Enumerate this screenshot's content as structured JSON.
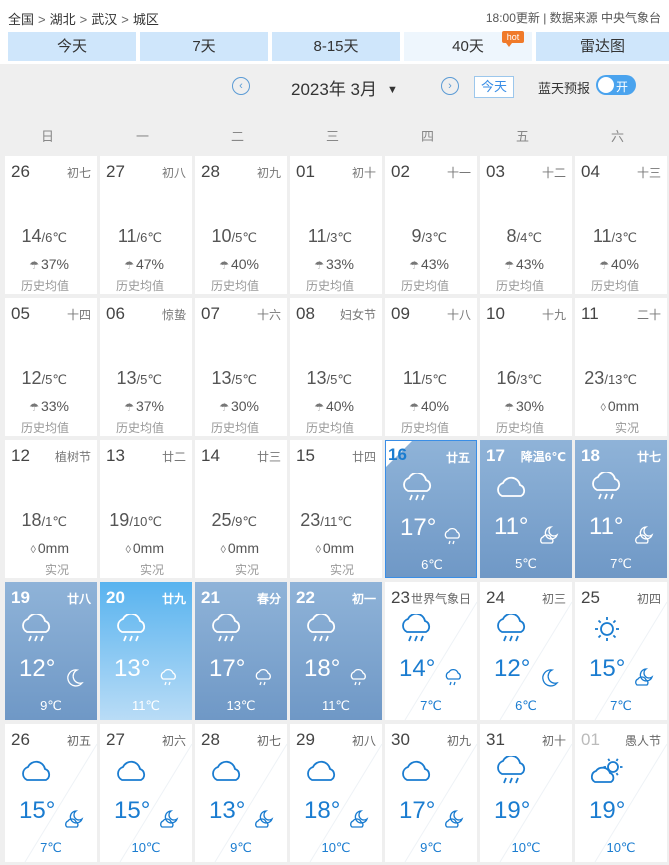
{
  "breadcrumb": {
    "items": [
      "全国",
      "湖北",
      "武汉",
      "城区"
    ],
    "sep": ">"
  },
  "source_text": "18:00更新 | 数据来源 中央气象台",
  "tabs": [
    {
      "label": "今天"
    },
    {
      "label": "7天"
    },
    {
      "label": "8-15天"
    },
    {
      "label": "40天",
      "badge": "hot",
      "active": true
    },
    {
      "label": "雷达图"
    }
  ],
  "controls": {
    "prev": "‹",
    "next": "›",
    "month_label": "2023年 3月",
    "caret": "▼",
    "today": "今天",
    "sky_label": "蓝天预报",
    "toggle_label": "开"
  },
  "weekdays": [
    "日",
    "一",
    "二",
    "三",
    "四",
    "五",
    "六"
  ],
  "history_label": "历史均值",
  "actual_label": "实况",
  "weeks": [
    [
      {
        "day": "26",
        "lunar": "初七",
        "kind": "hist",
        "high": "14",
        "low": "6℃",
        "rain": "37%"
      },
      {
        "day": "27",
        "lunar": "初八",
        "kind": "hist",
        "high": "11",
        "low": "6℃",
        "rain": "47%"
      },
      {
        "day": "28",
        "lunar": "初九",
        "kind": "hist",
        "high": "10",
        "low": "5℃",
        "rain": "40%"
      },
      {
        "day": "01",
        "lunar": "初十",
        "kind": "hist",
        "high": "11",
        "low": "3℃",
        "rain": "33%"
      },
      {
        "day": "02",
        "lunar": "十一",
        "kind": "hist",
        "high": "9",
        "low": "3℃",
        "rain": "43%"
      },
      {
        "day": "03",
        "lunar": "十二",
        "kind": "hist",
        "high": "8",
        "low": "4℃",
        "rain": "43%"
      },
      {
        "day": "04",
        "lunar": "十三",
        "kind": "hist",
        "high": "11",
        "low": "3℃",
        "rain": "40%"
      }
    ],
    [
      {
        "day": "05",
        "lunar": "十四",
        "kind": "hist",
        "high": "12",
        "low": "5℃",
        "rain": "33%"
      },
      {
        "day": "06",
        "lunar": "惊蛰",
        "kind": "hist",
        "high": "13",
        "low": "5℃",
        "rain": "37%"
      },
      {
        "day": "07",
        "lunar": "十六",
        "kind": "hist",
        "high": "13",
        "low": "5℃",
        "rain": "30%"
      },
      {
        "day": "08",
        "lunar": "妇女节",
        "kind": "hist",
        "high": "13",
        "low": "5℃",
        "rain": "40%"
      },
      {
        "day": "09",
        "lunar": "十八",
        "kind": "hist",
        "high": "11",
        "low": "5℃",
        "rain": "40%"
      },
      {
        "day": "10",
        "lunar": "十九",
        "kind": "hist",
        "high": "16",
        "low": "3℃",
        "rain": "30%"
      },
      {
        "day": "11",
        "lunar": "二十",
        "kind": "actual",
        "high": "23",
        "low": "13℃",
        "rain": "0mm"
      }
    ],
    [
      {
        "day": "12",
        "lunar": "植树节",
        "kind": "actual",
        "high": "18",
        "low": "1℃",
        "rain": "0mm"
      },
      {
        "day": "13",
        "lunar": "廿二",
        "kind": "actual",
        "high": "19",
        "low": "10℃",
        "rain": "0mm"
      },
      {
        "day": "14",
        "lunar": "廿三",
        "kind": "actual",
        "high": "25",
        "low": "9℃",
        "rain": "0mm"
      },
      {
        "day": "15",
        "lunar": "廿四",
        "kind": "actual",
        "high": "23",
        "low": "11℃",
        "rain": "0mm"
      },
      {
        "day": "16",
        "lunar": "廿五",
        "kind": "fc",
        "style": "blue",
        "today": true,
        "icon": "rain",
        "nicon": "rain",
        "hi": "17°",
        "lo": "6℃"
      },
      {
        "day": "17",
        "lunar": "降温6℃",
        "kind": "fc",
        "style": "blue",
        "icon": "cloud",
        "nicon": "moon-cloud",
        "hi": "11°",
        "lo": "5℃"
      },
      {
        "day": "18",
        "lunar": "廿七",
        "kind": "fc",
        "style": "blue",
        "icon": "rain",
        "nicon": "moon-cloud",
        "hi": "11°",
        "lo": "7℃"
      }
    ],
    [
      {
        "day": "19",
        "lunar": "廿八",
        "kind": "fc",
        "style": "blue",
        "icon": "rain",
        "nicon": "moon",
        "hi": "12°",
        "lo": "9℃"
      },
      {
        "day": "20",
        "lunar": "廿九",
        "kind": "fc",
        "style": "bright",
        "icon": "rain",
        "nicon": "rain",
        "hi": "13°",
        "lo": "11℃"
      },
      {
        "day": "21",
        "lunar": "春分",
        "kind": "fc",
        "style": "blue",
        "icon": "rain",
        "nicon": "rain",
        "hi": "17°",
        "lo": "13℃"
      },
      {
        "day": "22",
        "lunar": "初一",
        "kind": "fc",
        "style": "blue",
        "icon": "rain",
        "nicon": "rain",
        "hi": "18°",
        "lo": "11℃"
      },
      {
        "day": "23",
        "lunar": "世界气象日",
        "kind": "fc",
        "style": "white",
        "icon": "rain",
        "nicon": "rain",
        "hi": "14°",
        "lo": "7℃"
      },
      {
        "day": "24",
        "lunar": "初三",
        "kind": "fc",
        "style": "white",
        "icon": "rain",
        "nicon": "moon",
        "hi": "12°",
        "lo": "6℃"
      },
      {
        "day": "25",
        "lunar": "初四",
        "kind": "fc",
        "style": "white",
        "icon": "sun",
        "nicon": "moon-cloud",
        "hi": "15°",
        "lo": "7℃"
      }
    ],
    [
      {
        "day": "26",
        "lunar": "初五",
        "kind": "fc",
        "style": "white",
        "icon": "cloud",
        "nicon": "moon-cloud",
        "hi": "15°",
        "lo": "7℃"
      },
      {
        "day": "27",
        "lunar": "初六",
        "kind": "fc",
        "style": "white",
        "icon": "cloud",
        "nicon": "moon-cloud",
        "hi": "15°",
        "lo": "10℃"
      },
      {
        "day": "28",
        "lunar": "初七",
        "kind": "fc",
        "style": "white",
        "icon": "cloud",
        "nicon": "moon-cloud",
        "hi": "13°",
        "lo": "9℃"
      },
      {
        "day": "29",
        "lunar": "初八",
        "kind": "fc",
        "style": "white",
        "icon": "cloud",
        "nicon": "moon-cloud",
        "hi": "18°",
        "lo": "10℃"
      },
      {
        "day": "30",
        "lunar": "初九",
        "kind": "fc",
        "style": "white",
        "icon": "cloud",
        "nicon": "moon-cloud",
        "hi": "17°",
        "lo": "9℃"
      },
      {
        "day": "31",
        "lunar": "初十",
        "kind": "fc",
        "style": "white",
        "icon": "rain",
        "nicon": "none",
        "hi": "19°",
        "lo": "10℃"
      },
      {
        "day": "01",
        "lunar": "愚人节",
        "kind": "fc",
        "style": "white",
        "icon": "sun-cloud",
        "nicon": "none",
        "hi": "19°",
        "lo": "10℃",
        "muted": true
      }
    ]
  ]
}
